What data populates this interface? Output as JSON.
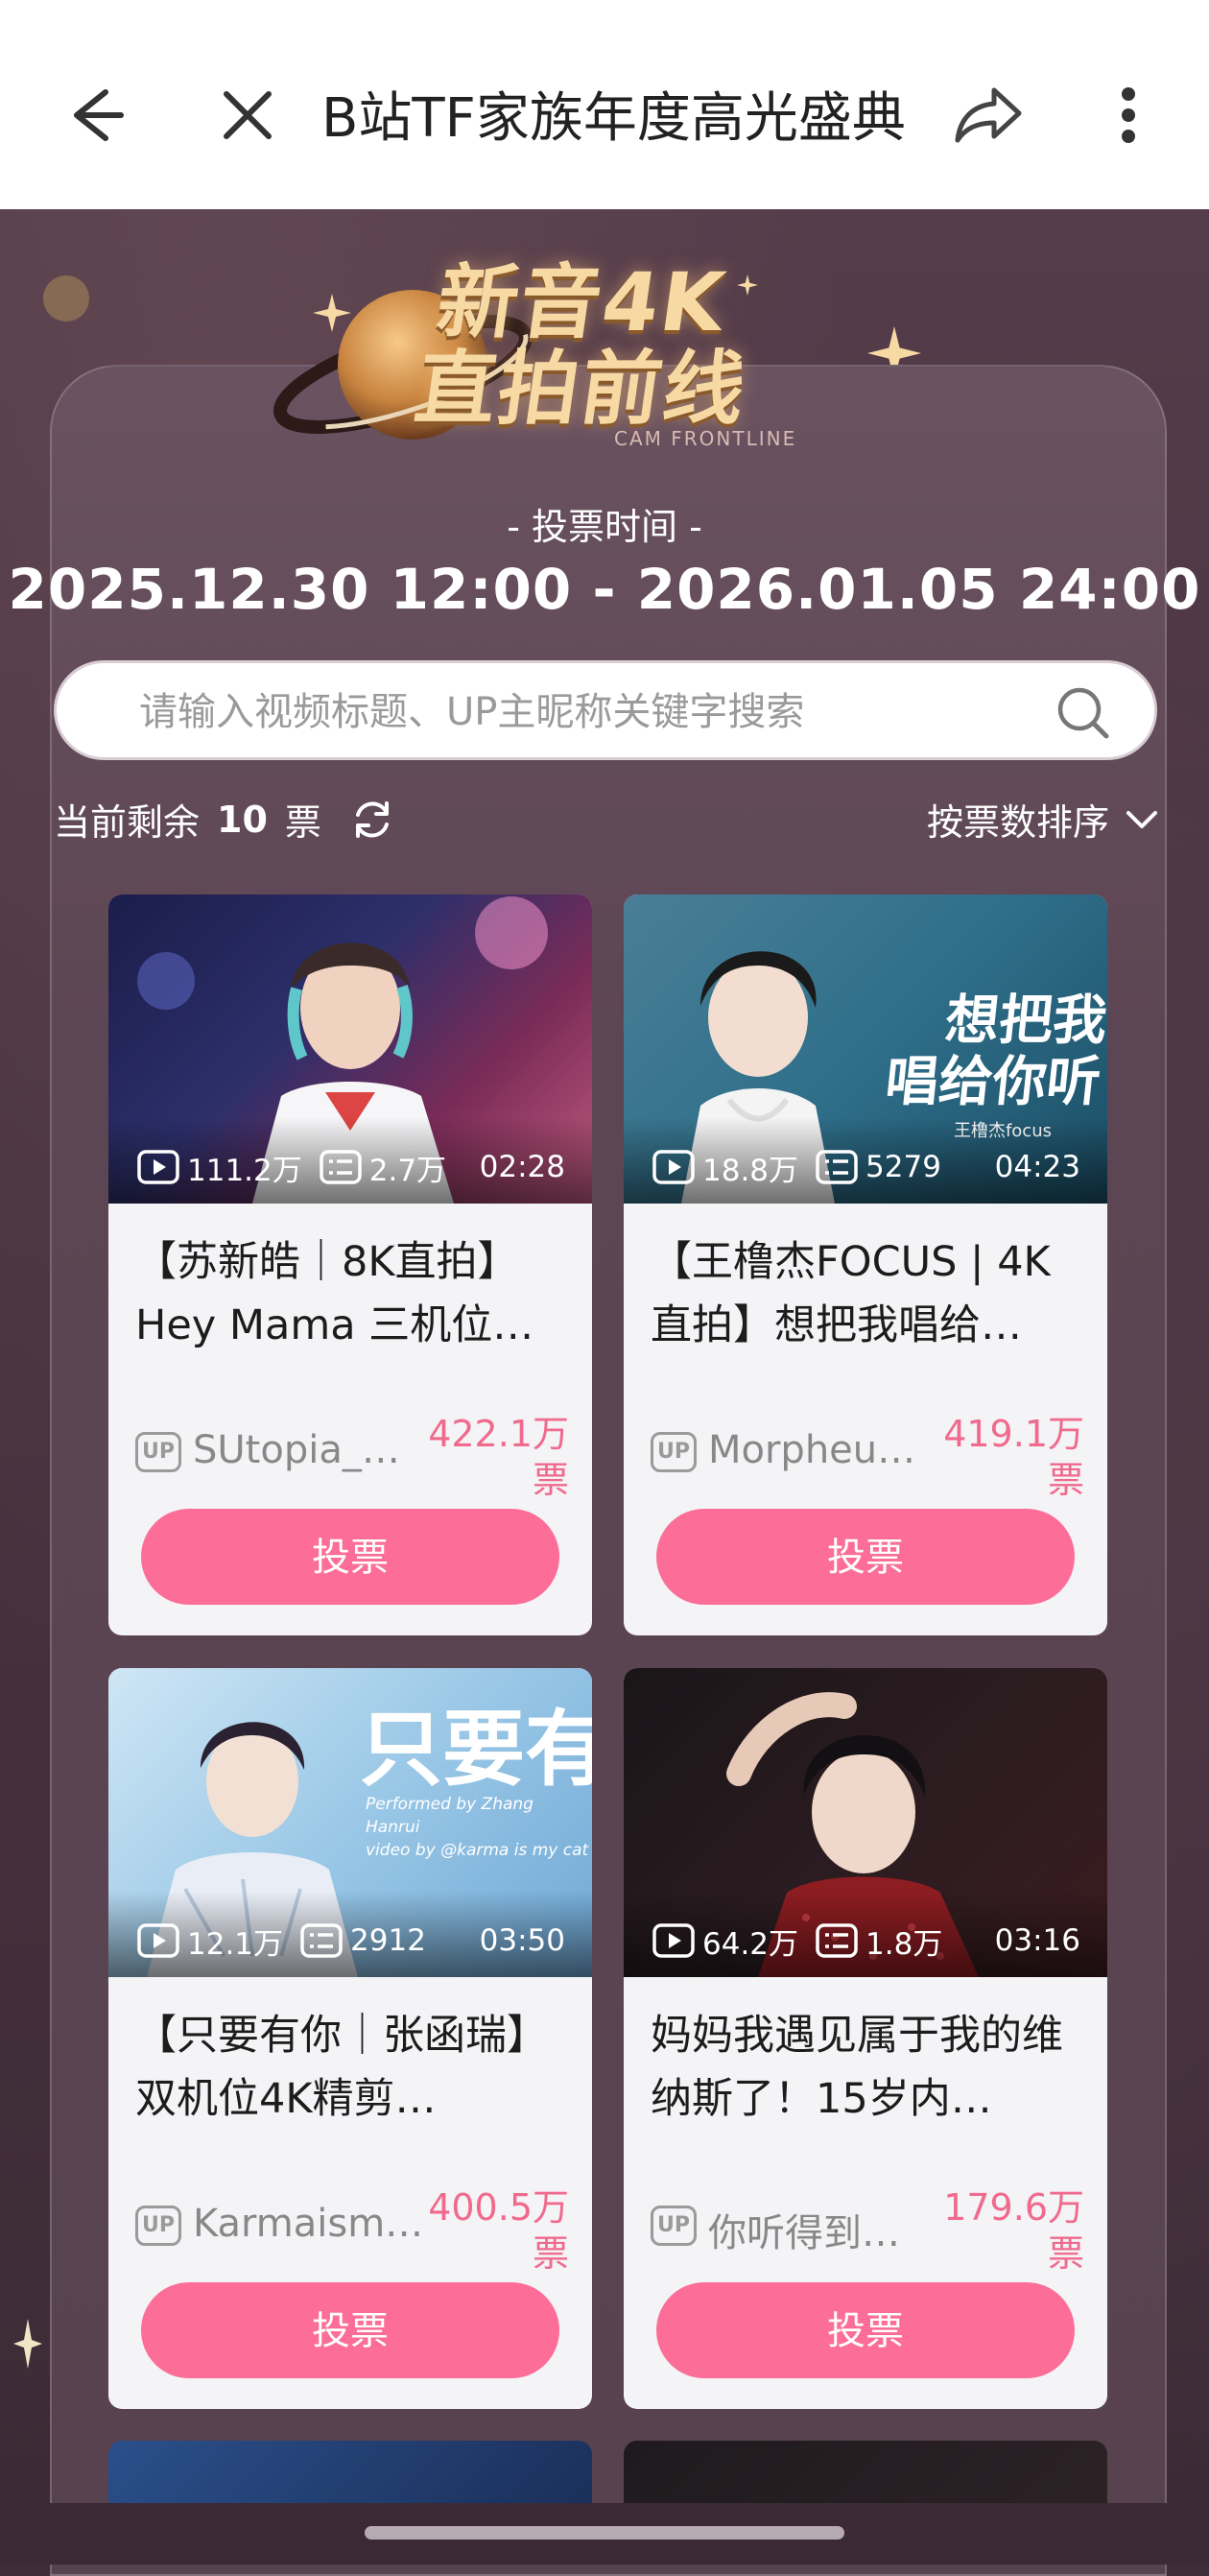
{
  "topbar": {
    "title": "B站TF家族年度高光盛典",
    "icons": [
      "back-arrow-icon",
      "close-icon",
      "share-icon",
      "more-icon"
    ]
  },
  "banner": {
    "title_line1": "新音4K",
    "title_line2": "直拍前线",
    "subtitle": "CAM FRONTLINE"
  },
  "vote_time": {
    "label": "- 投票时间 -",
    "range": "2025.12.30 12:00  - 2026.01.05 24:00"
  },
  "search": {
    "placeholder": "请输入视频标题、UP主昵称关键字搜索"
  },
  "remaining": {
    "prefix": "当前剩余",
    "count": "10",
    "suffix": "票"
  },
  "sort": {
    "label": "按票数排序"
  },
  "colors": {
    "accent": "#fc6d98",
    "votes_text": "#f06a8d"
  },
  "cards": [
    {
      "plays": "111.2万",
      "danmaku": "2.7万",
      "duration": "02:28",
      "title": "【苏新皓｜8K直拍】Hey Mama 三机位…",
      "author": "SUtopia_…",
      "votes_line1": "422.1万",
      "votes_line2": "票",
      "button": "投票"
    },
    {
      "plays": "18.8万",
      "danmaku": "5279",
      "duration": "04:23",
      "title": "【王橹杰FOCUS | 4K直拍】想把我唱给…",
      "author": "Morpheu…",
      "votes_line1": "419.1万",
      "votes_line2": "票",
      "button": "投票",
      "thumb_text": "想把我\n唱给你听",
      "thumb_caption": "王橹杰focus"
    },
    {
      "plays": "12.1万",
      "danmaku": "2912",
      "duration": "03:50",
      "title": "【只要有你｜张函瑞】双机位4K精剪…",
      "author": "Karmaism…",
      "votes_line1": "400.5万",
      "votes_line2": "票",
      "button": "投票",
      "thumb_text": "只要有你",
      "thumb_caption1": "Performed by Zhang Hanrui",
      "thumb_caption2": "video by @karma is my cat"
    },
    {
      "plays": "64.2万",
      "danmaku": "1.8万",
      "duration": "03:16",
      "title": "妈妈我遇见属于我的维纳斯了！15岁内…",
      "author": "你听得到…",
      "votes_line1": "179.6万",
      "votes_line2": "票",
      "button": "投票"
    }
  ]
}
